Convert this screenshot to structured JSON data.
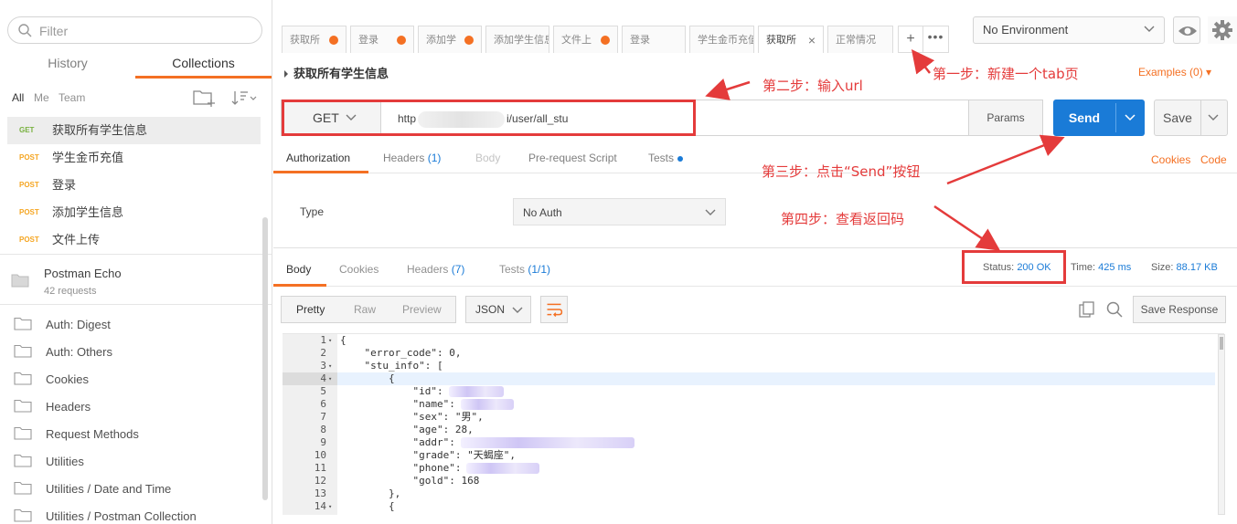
{
  "sidebar": {
    "filter_placeholder": "Filter",
    "tabs": [
      {
        "label": "History"
      },
      {
        "label": "Collections"
      }
    ],
    "filters": {
      "all": "All",
      "me": "Me",
      "team": "Team"
    },
    "requests": [
      {
        "method": "GET",
        "name": "获取所有学生信息"
      },
      {
        "method": "POST",
        "name": "学生金币充值"
      },
      {
        "method": "POST",
        "name": "登录"
      },
      {
        "method": "POST",
        "name": "添加学生信息"
      },
      {
        "method": "POST",
        "name": "文件上传"
      }
    ],
    "collection": {
      "name": "Postman Echo",
      "count": "42 requests"
    },
    "folders": [
      {
        "name": "Auth: Digest"
      },
      {
        "name": "Auth: Others"
      },
      {
        "name": "Cookies"
      },
      {
        "name": "Headers"
      },
      {
        "name": "Request Methods"
      },
      {
        "name": "Utilities"
      },
      {
        "name": "Utilities / Date and Time"
      },
      {
        "name": "Utilities / Postman Collection"
      }
    ]
  },
  "tabs": [
    {
      "label": "获取所"
    },
    {
      "label": "登录"
    },
    {
      "label": "添加学"
    },
    {
      "label": "添加学生信息"
    },
    {
      "label": "文件上"
    },
    {
      "label": "登录"
    },
    {
      "label": "学生金币充值"
    },
    {
      "label": "获取所"
    },
    {
      "label": "正常情况"
    }
  ],
  "tab_controls": {
    "plus": "+",
    "more": "•••"
  },
  "environment": {
    "selected": "No Environment"
  },
  "request": {
    "title": "获取所有学生信息",
    "examples": "Examples (0) ▾",
    "method": "GET",
    "url_prefix": "http",
    "url_suffix": "i/user/all_stu",
    "params": "Params",
    "send": "Send",
    "save": "Save"
  },
  "request_tabs": {
    "authorization": "Authorization",
    "headers": "Headers",
    "headers_count": "(1)",
    "body": "Body",
    "prerequest": "Pre-request Script",
    "tests": "Tests",
    "cookies": "Cookies",
    "code": "Code"
  },
  "auth": {
    "type_label": "Type",
    "type_value": "No Auth"
  },
  "response_tabs": {
    "body": "Body",
    "cookies": "Cookies",
    "headers": "Headers",
    "headers_count": "(7)",
    "tests": "Tests",
    "tests_count": "(1/1)"
  },
  "response_meta": {
    "status_label": "Status:",
    "status_value": "200 OK",
    "time_label": "Time:",
    "time_value": "425 ms",
    "size_label": "Size:",
    "size_value": "88.17 KB"
  },
  "response_toolbar": {
    "pretty": "Pretty",
    "raw": "Raw",
    "preview": "Preview",
    "format": "JSON",
    "save_response": "Save Response"
  },
  "code_lines": [
    {
      "n": "1",
      "fold": "▾",
      "text": "{"
    },
    {
      "n": "2",
      "fold": "",
      "text": "    \"error_code\": 0,"
    },
    {
      "n": "3",
      "fold": "▾",
      "text": "    \"stu_info\": ["
    },
    {
      "n": "4",
      "fold": "▾",
      "text": "        {"
    },
    {
      "n": "5",
      "fold": "",
      "text": "            \"id\":"
    },
    {
      "n": "6",
      "fold": "",
      "text": "            \"name\":"
    },
    {
      "n": "7",
      "fold": "",
      "text": "            \"sex\": \"男\","
    },
    {
      "n": "8",
      "fold": "",
      "text": "            \"age\": 28,"
    },
    {
      "n": "9",
      "fold": "",
      "text": "            \"addr\":"
    },
    {
      "n": "10",
      "fold": "",
      "text": "            \"grade\": \"天蝎座\","
    },
    {
      "n": "11",
      "fold": "",
      "text": "            \"phone\":"
    },
    {
      "n": "12",
      "fold": "",
      "text": "            \"gold\": 168"
    },
    {
      "n": "13",
      "fold": "",
      "text": "        },"
    },
    {
      "n": "14",
      "fold": "▾",
      "text": "        {"
    }
  ],
  "annotations": {
    "step1": "第一步：新建一个tab页",
    "step2": "第二步：输入url",
    "step3": "第三步：点击“Send”按钮",
    "step4": "第四步：查看返回码"
  },
  "colors": {
    "accent": "#f47023",
    "send_blue": "#1a7bd7",
    "annotation_red": "#e43b3b",
    "get_green": "#78b13f",
    "post_orange": "#f5a623"
  }
}
